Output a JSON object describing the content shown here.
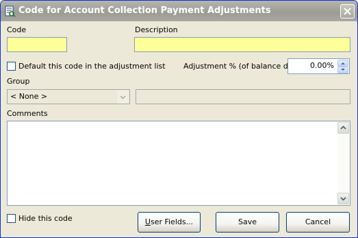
{
  "window": {
    "title": "Code for Account Collection Payment Adjustments",
    "icon": "document-edit-icon",
    "close_icon": "close-icon"
  },
  "form": {
    "code_label": "Code",
    "code_value": "",
    "description_label": "Description",
    "description_value": "",
    "default_checkbox_label": "Default this code in the adjustment list",
    "default_checked": false,
    "adjustment_label": "Adjustment % (of balance due)",
    "adjustment_value": "0.00%",
    "group_label": "Group",
    "group_selected": "< None >",
    "group_detail_value": "",
    "comments_label": "Comments",
    "comments_value": "",
    "hide_checkbox_label": "Hide this code",
    "hide_checked": false
  },
  "buttons": {
    "user_fields_underline": "U",
    "user_fields_rest": "ser Fields...",
    "save": "Save",
    "cancel": "Cancel"
  },
  "colors": {
    "required_field": "#ffff9a",
    "window_face": "#ece9d8",
    "title_inactive": "#a4a39b"
  }
}
